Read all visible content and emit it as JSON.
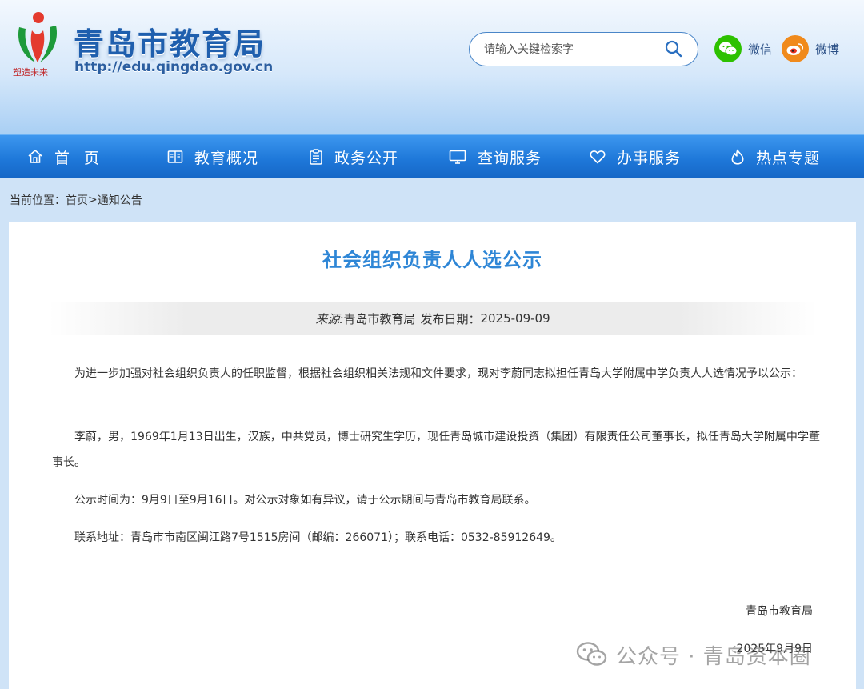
{
  "header": {
    "site_title": "青岛市教育局",
    "site_url": "http://edu.qingdao.gov.cn",
    "logo_motto": "塑造未来",
    "search": {
      "placeholder": "请输入关键检索字"
    },
    "social": [
      {
        "label": "微信",
        "icon": "wechat-icon",
        "color": "#2dc100"
      },
      {
        "label": "微博",
        "icon": "weibo-icon",
        "color": "#f08a1c"
      }
    ]
  },
  "nav": {
    "items": [
      {
        "label": "首页",
        "icon": "home-icon"
      },
      {
        "label": "教育概况",
        "icon": "book-icon"
      },
      {
        "label": "政务公开",
        "icon": "clipboard-icon"
      },
      {
        "label": "查询服务",
        "icon": "monitor-icon"
      },
      {
        "label": "办事服务",
        "icon": "heart-icon"
      },
      {
        "label": "热点专题",
        "icon": "flame-icon"
      }
    ]
  },
  "breadcrumb": {
    "prefix": "当前位置：",
    "home": "首页",
    "separator": ">",
    "current": "通知公告"
  },
  "article": {
    "title": "社会组织负责人人选公示",
    "source_label": "来源:",
    "source": "青岛市教育局",
    "date_label": "发布日期：",
    "date": "2025-09-09",
    "paragraphs": [
      "为进一步加强对社会组织负责人的任职监督，根据社会组织相关法规和文件要求，现对李蔚同志拟担任青岛大学附属中学负责人人选情况予以公示：",
      "李蔚，男，1969年1月13日出生，汉族，中共党员，博士研究生学历，现任青岛城市建设投资（集团）有限责任公司董事长，拟任青岛大学附属中学董事长。",
      "公示时间为：9月9日至9月16日。对公示对象如有异议，请于公示期间与青岛市教育局联系。",
      "联系地址：青岛市市南区闽江路7号1515房间（邮编：266071）；联系电话：0532-85912649。"
    ],
    "signature_org": "青岛市教育局",
    "signature_date": "2025年9月9日"
  },
  "watermark": {
    "text": "公众号 · 青岛资本圈"
  },
  "colors": {
    "brand_blue": "#1f79da",
    "title_blue": "#2e86d6"
  }
}
